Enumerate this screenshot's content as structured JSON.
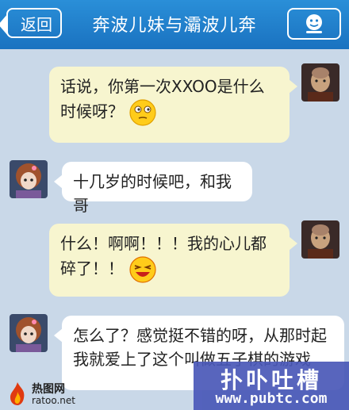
{
  "header": {
    "back_label": "返回",
    "title": "奔波儿妹与灞波儿奔",
    "profile_icon": "user-profile-icon"
  },
  "messages": [
    {
      "side": "right",
      "text": "话说，你第一次XXOO是什么时候呀？",
      "emoji": "thinking-emoji"
    },
    {
      "side": "left",
      "text": "十几岁的时候吧，和我哥"
    },
    {
      "side": "right",
      "text": "什么！啊啊！！！我的心儿都碎了！！",
      "emoji": "laughing-emoji"
    },
    {
      "side": "left",
      "text": "怎么了？感觉挺不错的呀，从那时起我就爱上了这个叫做五子棋的游戏"
    }
  ],
  "watermark": {
    "site_name": "热图网",
    "site_url": "ratoo.net",
    "brand": "扑卟吐槽",
    "brand_url": "www.pubtc.com"
  },
  "colors": {
    "header": "#1f7fcc",
    "background": "#c9d8e8",
    "bubble_self": "#f7f5cf",
    "bubble_other": "#ffffff",
    "watermark": "#4a58b8"
  }
}
